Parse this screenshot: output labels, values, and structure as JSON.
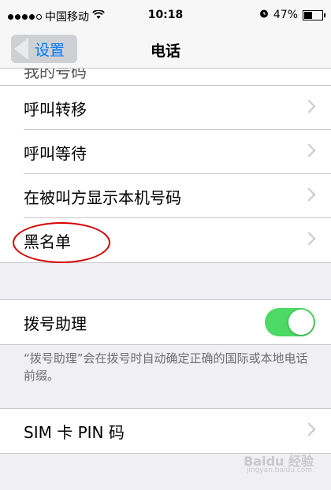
{
  "status": {
    "carrier": "中国移动",
    "time": "10:18",
    "battery": "47%",
    "battery_level": 0.47,
    "icons": [
      "signal-dots",
      "wifi-icon",
      "alarm-icon",
      "battery-icon"
    ]
  },
  "nav": {
    "back_label": "设置",
    "title": "电话"
  },
  "cutoff_text": "我的号码",
  "group1": [
    {
      "label": "呼叫转移"
    },
    {
      "label": "呼叫等待"
    },
    {
      "label": "在被叫方显示本机号码"
    },
    {
      "label": "黑名单"
    }
  ],
  "dial_assist": {
    "label": "拨号助理",
    "enabled": true
  },
  "footnote": "“拨号助理”会在拨号时自动确定正确的国际或本地电话前缀。",
  "sim_pin": {
    "label": "SIM 卡 PIN 码"
  },
  "watermark": {
    "text": "Baidu 经验",
    "sub": "jingyan.baidu.com"
  },
  "colors": {
    "accent": "#007aff",
    "toggle_on": "#4cd964",
    "annotation": "#d40000"
  }
}
